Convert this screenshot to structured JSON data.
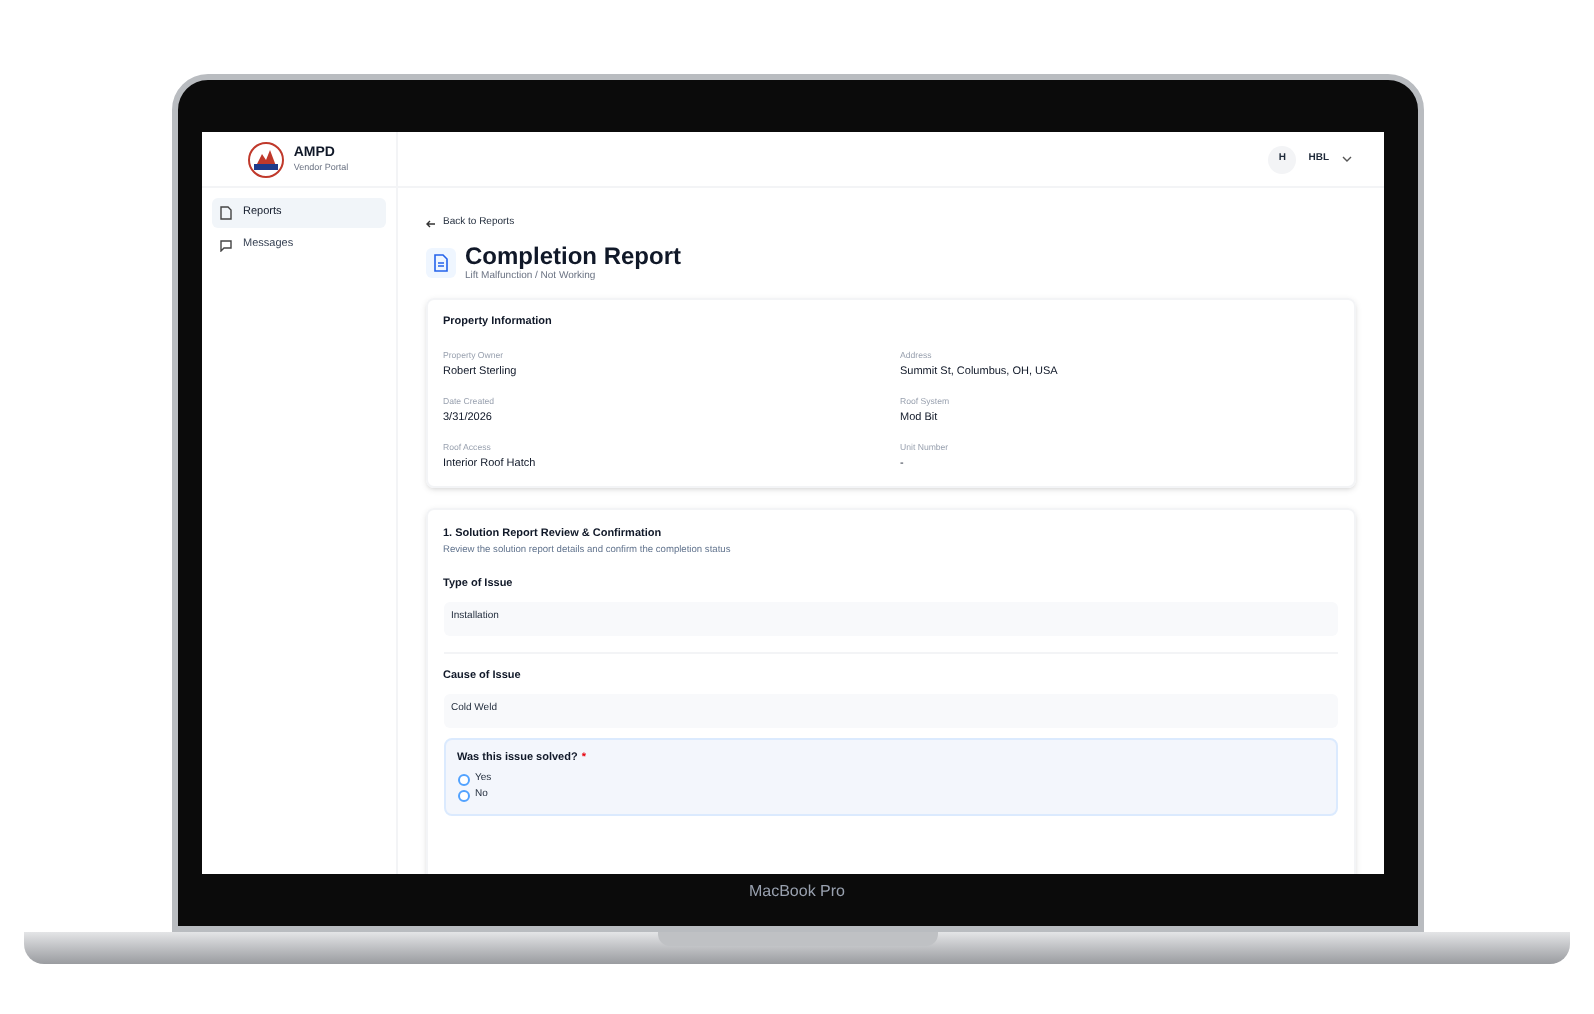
{
  "brand": {
    "name": "AMPD",
    "subtitle": "Vendor Portal"
  },
  "sidebar": {
    "items": [
      {
        "label": "Reports",
        "selected": true
      },
      {
        "label": "Messages",
        "selected": false
      }
    ]
  },
  "user": {
    "initial": "H",
    "name": "HBL"
  },
  "back_link": "Back to Reports",
  "title": "Completion Report",
  "subtitle": "Lift Malfunction / Not Working",
  "property": {
    "heading": "Property Information",
    "fields": [
      {
        "label": "Property Owner",
        "value": "Robert Sterling"
      },
      {
        "label": "Address",
        "value": "Summit St, Columbus, OH, USA"
      },
      {
        "label": "Date Created",
        "value": "3/31/2026"
      },
      {
        "label": "Roof System",
        "value": "Mod Bit"
      },
      {
        "label": "Roof Access",
        "value": "Interior Roof Hatch"
      },
      {
        "label": "Unit Number",
        "value": "-"
      }
    ]
  },
  "section": {
    "heading": "1. Solution Report Review & Confirmation",
    "description": "Review the solution report details and confirm the completion status",
    "fields": [
      {
        "label": "Type of Issue",
        "value": "Installation"
      },
      {
        "label": "Cause of Issue",
        "value": "Cold Weld"
      }
    ],
    "question": {
      "label": "Was this issue solved?",
      "required_mark": "*",
      "options": [
        {
          "label": "Yes",
          "selected": false
        },
        {
          "label": "No",
          "selected": false
        }
      ]
    }
  },
  "device_label": "MacBook Pro"
}
